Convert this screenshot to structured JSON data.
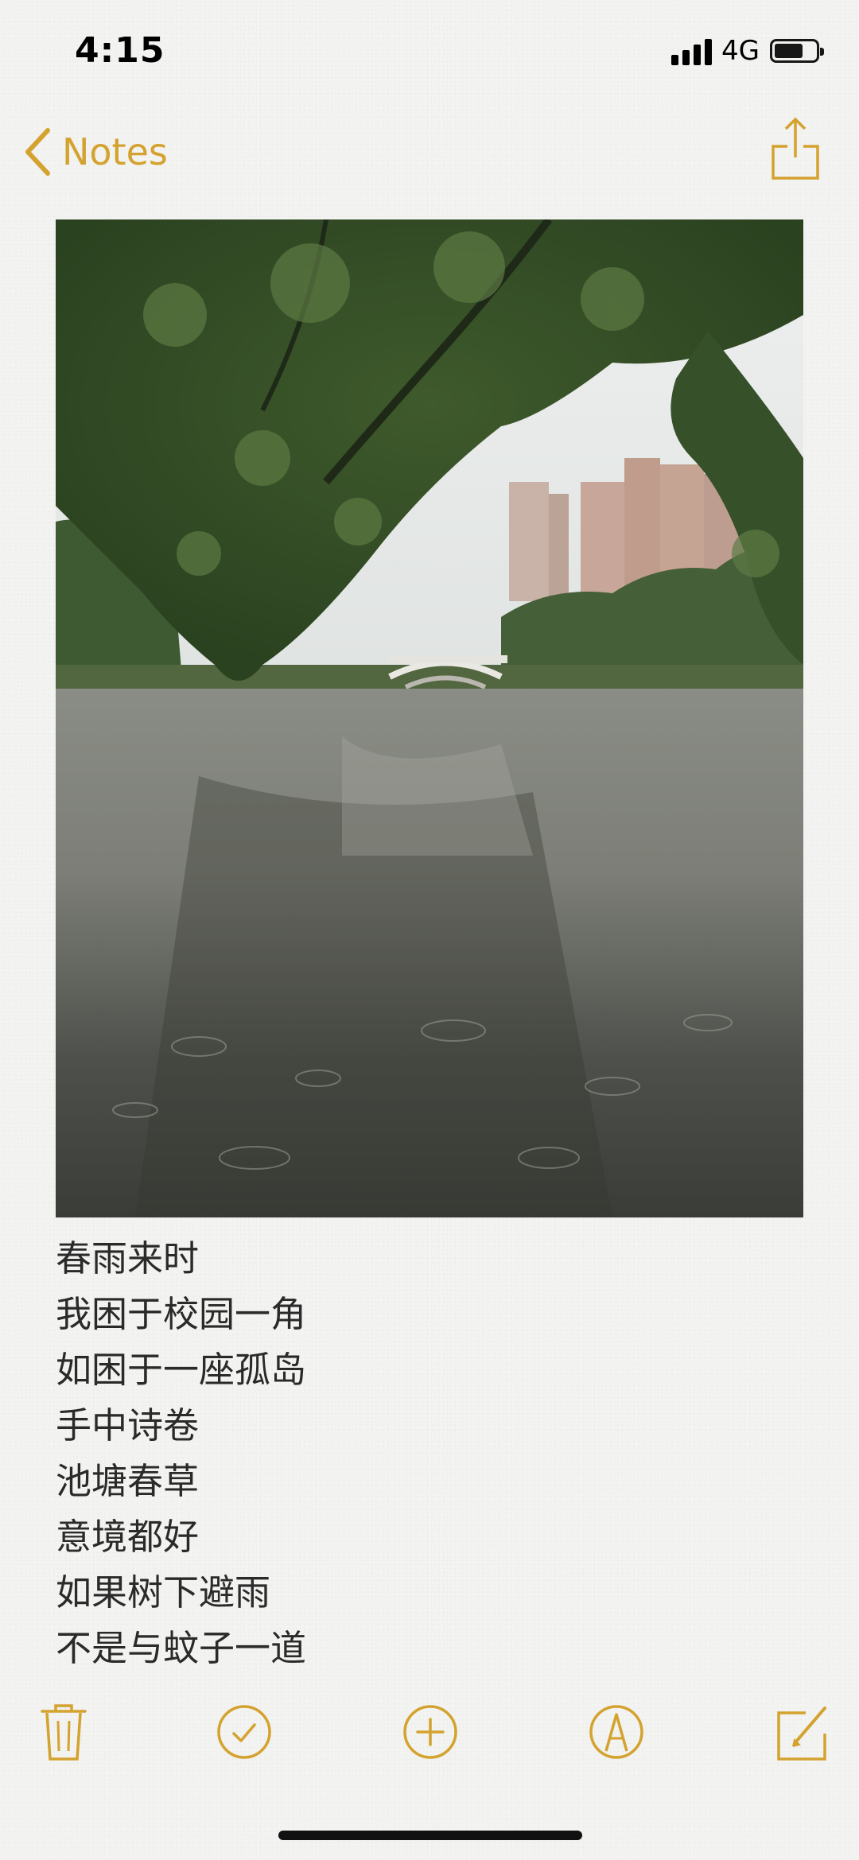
{
  "status_bar": {
    "time": "4:15",
    "network": "4G",
    "battery_level": 0.7
  },
  "nav": {
    "back_label": "Notes",
    "back_icon": "chevron-left-icon",
    "share_icon": "share-icon"
  },
  "note": {
    "photo_subject": "rainy lake with arched bridge, overhanging tree and high-rise buildings",
    "lines": [
      "春雨来时",
      "我困于校园一角",
      "如困于一座孤岛",
      "手中诗卷",
      "池塘春草",
      "意境都好",
      "如果树下避雨",
      "不是与蚊子一道"
    ]
  },
  "toolbar": {
    "icons": [
      "trash-icon",
      "checklist-icon",
      "add-icon",
      "markup-icon",
      "compose-icon"
    ]
  },
  "colors": {
    "accent": "#d4a22f",
    "background": "#f3f3f1",
    "text": "#2a2a2a"
  }
}
